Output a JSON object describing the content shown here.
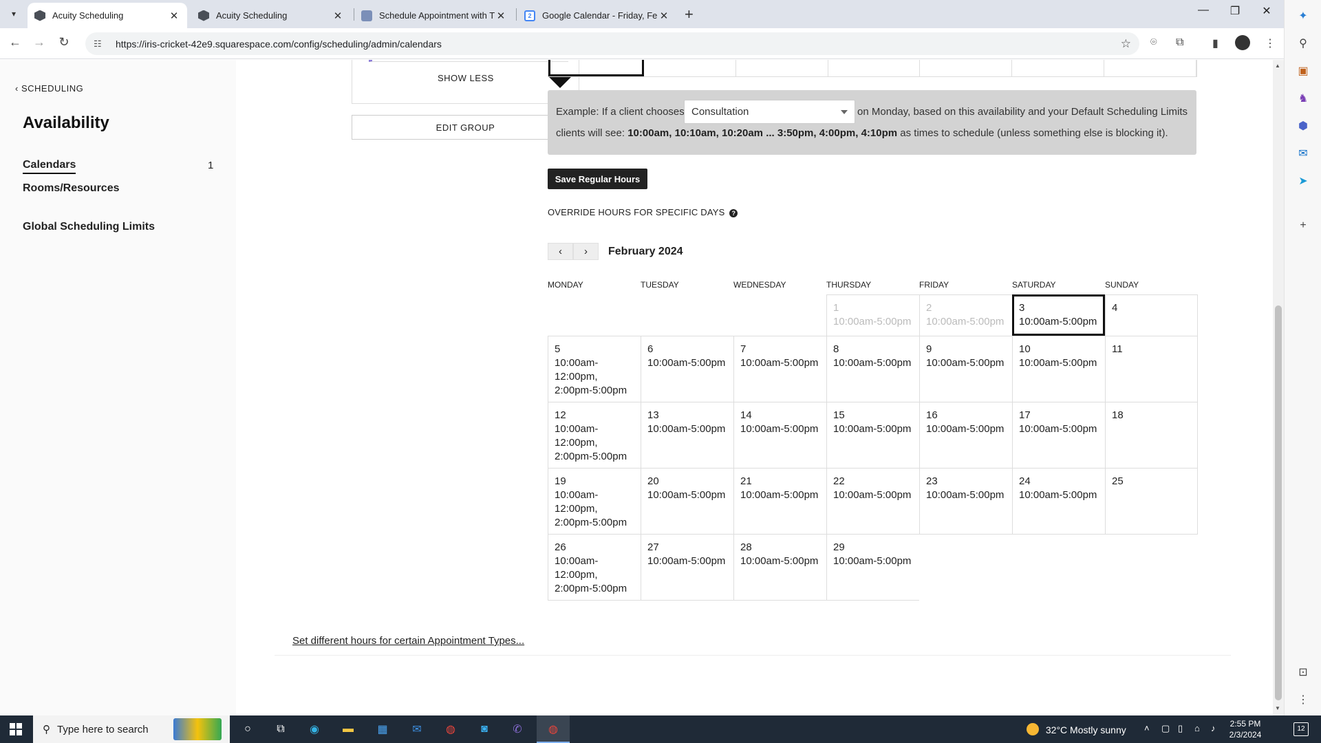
{
  "browser": {
    "tabs": [
      {
        "title": "Acuity Scheduling",
        "active": true,
        "icon": "acuity-icon"
      },
      {
        "title": "Acuity Scheduling",
        "active": false,
        "icon": "acuity-icon"
      },
      {
        "title": "Schedule Appointment with Th",
        "active": false,
        "icon": "schedule-icon"
      },
      {
        "title": "Google Calendar - Friday, Febru",
        "active": false,
        "icon": "google-calendar-icon"
      }
    ],
    "url": "https://iris-cricket-42e9.squarespace.com/config/scheduling/admin/calendars"
  },
  "sidebar": {
    "back_label": "SCHEDULING",
    "title": "Availability",
    "items": [
      {
        "label": "Calendars",
        "count": "1",
        "active": true
      },
      {
        "label": "Rooms/Resources"
      },
      {
        "label": "Global Scheduling Limits"
      }
    ]
  },
  "group": {
    "show_less": "SHOW LESS",
    "edit_group": "EDIT GROUP"
  },
  "example": {
    "prefix": "Example: If a client chooses",
    "selected_type": "Consultation",
    "suffix": "on Monday, based on this availability and your Default Scheduling Limits",
    "line2_prefix": "clients will see:",
    "line2_times": "10:00am, 10:10am, 10:20am ... 3:50pm, 4:00pm, 4:10pm",
    "line2_suffix": "as times to schedule (unless something else is blocking it)."
  },
  "save_button": "Save Regular Hours",
  "override_title": "OVERRIDE HOURS FOR SPECIFIC DAYS",
  "calendar": {
    "month": "February 2024",
    "weekdays": [
      "MONDAY",
      "TUESDAY",
      "WEDNESDAY",
      "THURSDAY",
      "FRIDAY",
      "SATURDAY",
      "SUNDAY"
    ],
    "weeks": [
      [
        {
          "day": "",
          "hours": ""
        },
        {
          "day": "",
          "hours": ""
        },
        {
          "day": "",
          "hours": ""
        },
        {
          "day": "1",
          "hours": "10:00am-5:00pm",
          "muted": true
        },
        {
          "day": "2",
          "hours": "10:00am-5:00pm",
          "muted": true
        },
        {
          "day": "3",
          "hours": "10:00am-5:00pm",
          "selected": true
        },
        {
          "day": "4",
          "hours": ""
        }
      ],
      [
        {
          "day": "5",
          "hours": "10:00am-12:00pm, 2:00pm-5:00pm"
        },
        {
          "day": "6",
          "hours": "10:00am-5:00pm"
        },
        {
          "day": "7",
          "hours": "10:00am-5:00pm"
        },
        {
          "day": "8",
          "hours": "10:00am-5:00pm"
        },
        {
          "day": "9",
          "hours": "10:00am-5:00pm"
        },
        {
          "day": "10",
          "hours": "10:00am-5:00pm"
        },
        {
          "day": "11",
          "hours": ""
        }
      ],
      [
        {
          "day": "12",
          "hours": "10:00am-12:00pm, 2:00pm-5:00pm"
        },
        {
          "day": "13",
          "hours": "10:00am-5:00pm"
        },
        {
          "day": "14",
          "hours": "10:00am-5:00pm"
        },
        {
          "day": "15",
          "hours": "10:00am-5:00pm"
        },
        {
          "day": "16",
          "hours": "10:00am-5:00pm"
        },
        {
          "day": "17",
          "hours": "10:00am-5:00pm"
        },
        {
          "day": "18",
          "hours": ""
        }
      ],
      [
        {
          "day": "19",
          "hours": "10:00am-12:00pm, 2:00pm-5:00pm"
        },
        {
          "day": "20",
          "hours": "10:00am-5:00pm"
        },
        {
          "day": "21",
          "hours": "10:00am-5:00pm"
        },
        {
          "day": "22",
          "hours": "10:00am-5:00pm"
        },
        {
          "day": "23",
          "hours": "10:00am-5:00pm"
        },
        {
          "day": "24",
          "hours": "10:00am-5:00pm"
        },
        {
          "day": "25",
          "hours": ""
        }
      ],
      [
        {
          "day": "26",
          "hours": "10:00am-12:00pm, 2:00pm-5:00pm"
        },
        {
          "day": "27",
          "hours": "10:00am-5:00pm"
        },
        {
          "day": "28",
          "hours": "10:00am-5:00pm"
        },
        {
          "day": "29",
          "hours": "10:00am-5:00pm"
        },
        {
          "day": "",
          "hours": "",
          "blank": true
        },
        {
          "day": "",
          "hours": "",
          "blank": true
        },
        {
          "day": "",
          "hours": "",
          "blank": true
        }
      ]
    ]
  },
  "set_hours_link": "Set different hours for certain Appointment Types...",
  "taskbar": {
    "search_placeholder": "Type here to search",
    "weather": "32°C  Mostly sunny",
    "time": "2:55 PM",
    "date": "2/3/2024",
    "notifications": "12"
  }
}
